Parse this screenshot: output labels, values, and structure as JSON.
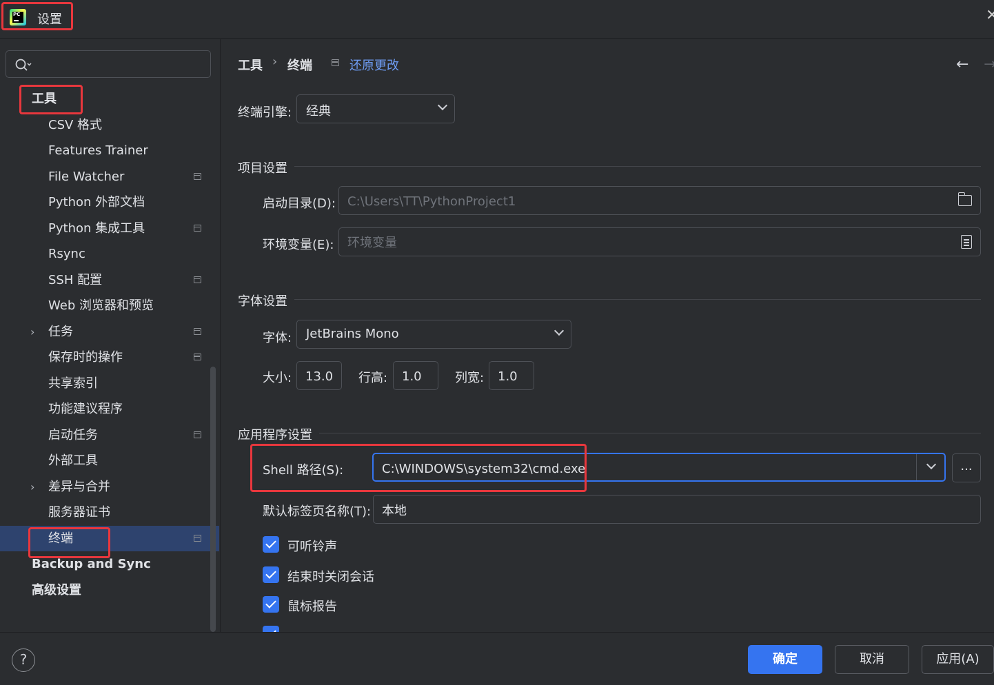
{
  "window": {
    "title": "设置",
    "app_logo_text": "PC"
  },
  "sidebar": {
    "search": {
      "value": "",
      "placeholder": ""
    },
    "items": [
      {
        "label": "工具",
        "level": 0,
        "bold": true
      },
      {
        "label": "CSV 格式",
        "level": 1
      },
      {
        "label": "Features Trainer",
        "level": 1
      },
      {
        "label": "File Watcher",
        "level": 1,
        "project_icon": true
      },
      {
        "label": "Python 外部文档",
        "level": 1
      },
      {
        "label": "Python 集成工具",
        "level": 1,
        "project_icon": true
      },
      {
        "label": "Rsync",
        "level": 1
      },
      {
        "label": "SSH 配置",
        "level": 1,
        "project_icon": true
      },
      {
        "label": "Web 浏览器和预览",
        "level": 1
      },
      {
        "label": "任务",
        "level": 1,
        "expandable": true,
        "project_icon": true
      },
      {
        "label": "保存时的操作",
        "level": 1,
        "project_icon": true
      },
      {
        "label": "共享索引",
        "level": 1
      },
      {
        "label": "功能建议程序",
        "level": 1
      },
      {
        "label": "启动任务",
        "level": 1,
        "project_icon": true
      },
      {
        "label": "外部工具",
        "level": 1
      },
      {
        "label": "差异与合并",
        "level": 1,
        "expandable": true
      },
      {
        "label": "服务器证书",
        "level": 1
      },
      {
        "label": "终端",
        "level": 1,
        "selected": true,
        "project_icon": true
      },
      {
        "label": "Backup and Sync",
        "level": 0,
        "bold": true
      },
      {
        "label": "高级设置",
        "level": 0,
        "bold": true
      }
    ]
  },
  "header": {
    "breadcrumb": [
      "工具",
      "终端"
    ],
    "separator": "›",
    "reset_link": "还原更改"
  },
  "terminal_engine": {
    "label": "终端引擎:",
    "value": "经典"
  },
  "project_settings": {
    "title": "项目设置",
    "start_dir": {
      "label": "启动目录(D):",
      "value": "C:\\Users\\TT\\PythonProject1"
    },
    "env_vars": {
      "label": "环境变量(E):",
      "placeholder": "环境变量"
    }
  },
  "font_settings": {
    "title": "字体设置",
    "font": {
      "label": "字体:",
      "value": "JetBrains Mono"
    },
    "size": {
      "label": "大小:",
      "value": "13.0"
    },
    "line_height": {
      "label": "行高:",
      "value": "1.0"
    },
    "column_width": {
      "label": "列宽:",
      "value": "1.0"
    }
  },
  "app_settings": {
    "title": "应用程序设置",
    "shell_path": {
      "label": "Shell 路径(S):",
      "value": "C:\\WINDOWS\\system32\\cmd.exe",
      "browse": "..."
    },
    "default_tab_name": {
      "label": "默认标签页名称(T):",
      "value": "本地"
    },
    "checkboxes": [
      {
        "label": "可听铃声",
        "checked": true
      },
      {
        "label": "结束时关闭会话",
        "checked": true
      },
      {
        "label": "鼠标报告",
        "checked": true
      }
    ]
  },
  "footer": {
    "help": "?",
    "ok": "确定",
    "cancel": "取消",
    "apply": "应用(A)"
  },
  "colors": {
    "background": "#2b2d30",
    "accent": "#3574f0",
    "link": "#6d9bf1",
    "selection": "#2e436e",
    "highlight_box": "#e8373d"
  }
}
